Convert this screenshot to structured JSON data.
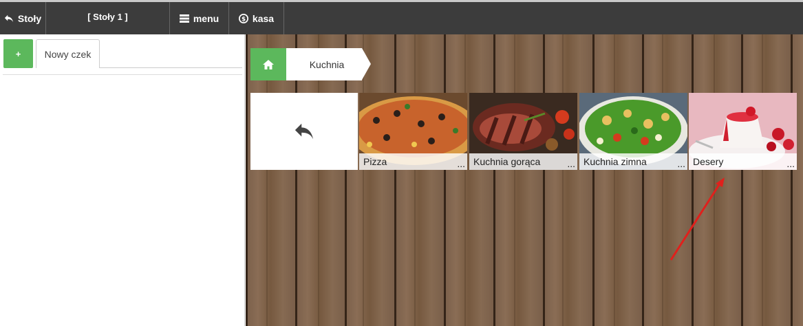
{
  "topbar": {
    "back_label": "Stoły",
    "table_label": "[ Stoły 1 ]",
    "menu_label": "menu",
    "kasa_label": "kasa"
  },
  "left_panel": {
    "add_label": "+",
    "check_tab_label": "Nowy czek"
  },
  "breadcrumb": {
    "items": [
      "Kuchnia"
    ]
  },
  "categories": [
    {
      "label": "Pizza",
      "more": "..."
    },
    {
      "label": "Kuchnia gorąca",
      "more": "..."
    },
    {
      "label": "Kuchnia zimna",
      "more": "..."
    },
    {
      "label": "Desery",
      "more": "..."
    }
  ],
  "colors": {
    "accent_green": "#5cb85c",
    "topbar": "#3c3c3c",
    "annotation": "#e0201c"
  },
  "icons": {
    "back": "undo-arrow-icon",
    "menu": "hamburger-icon",
    "kasa": "dollar-circle-icon",
    "home": "home-icon"
  }
}
